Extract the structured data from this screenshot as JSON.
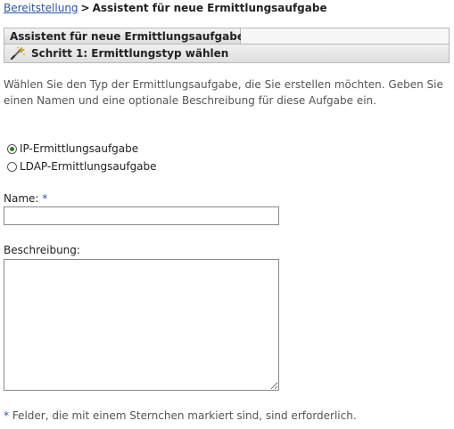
{
  "breadcrumb": {
    "link": "Bereitstellung",
    "separator": ">",
    "current": "Assistent für neue Ermittlungsaufgabe"
  },
  "wizard": {
    "tab_title": "Assistent für neue Ermittlungsaufgabe",
    "step_title": "Schritt 1: Ermittlungstyp wählen",
    "step_icon": "wand-icon"
  },
  "intro_text": "Wählen Sie den Typ der Ermittlungsaufgabe, die Sie erstellen möchten. Geben Sie einen Namen und eine optionale Beschreibung für diese Aufgabe ein.",
  "task_types": [
    {
      "label": "IP-Ermittlungsaufgabe",
      "checked": true
    },
    {
      "label": "LDAP-Ermittlungsaufgabe",
      "checked": false
    }
  ],
  "form": {
    "name_label": "Name:",
    "required_marker": "*",
    "name_value": "",
    "description_label": "Beschreibung:",
    "description_value": ""
  },
  "footnote": {
    "marker": "*",
    "text": " Felder, die mit einem Sternchen markiert sind, sind erforderlich."
  }
}
